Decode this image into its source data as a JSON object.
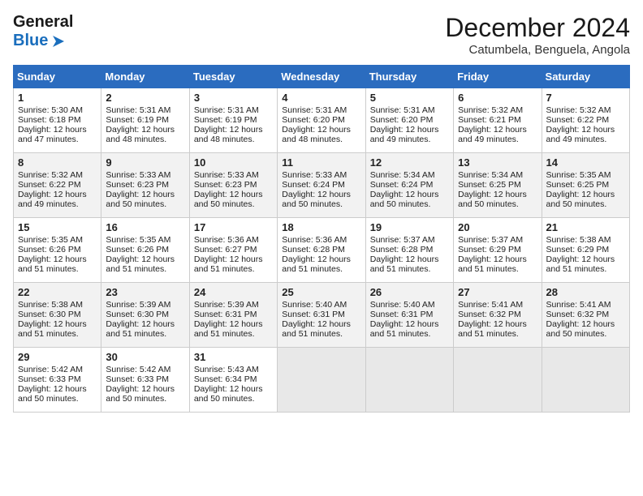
{
  "header": {
    "logo_line1": "General",
    "logo_line2": "Blue",
    "month": "December 2024",
    "location": "Catumbela, Benguela, Angola"
  },
  "weekdays": [
    "Sunday",
    "Monday",
    "Tuesday",
    "Wednesday",
    "Thursday",
    "Friday",
    "Saturday"
  ],
  "weeks": [
    [
      {
        "day": 1,
        "lines": [
          "Sunrise: 5:30 AM",
          "Sunset: 6:18 PM",
          "Daylight: 12 hours",
          "and 47 minutes."
        ]
      },
      {
        "day": 2,
        "lines": [
          "Sunrise: 5:31 AM",
          "Sunset: 6:19 PM",
          "Daylight: 12 hours",
          "and 48 minutes."
        ]
      },
      {
        "day": 3,
        "lines": [
          "Sunrise: 5:31 AM",
          "Sunset: 6:19 PM",
          "Daylight: 12 hours",
          "and 48 minutes."
        ]
      },
      {
        "day": 4,
        "lines": [
          "Sunrise: 5:31 AM",
          "Sunset: 6:20 PM",
          "Daylight: 12 hours",
          "and 48 minutes."
        ]
      },
      {
        "day": 5,
        "lines": [
          "Sunrise: 5:31 AM",
          "Sunset: 6:20 PM",
          "Daylight: 12 hours",
          "and 49 minutes."
        ]
      },
      {
        "day": 6,
        "lines": [
          "Sunrise: 5:32 AM",
          "Sunset: 6:21 PM",
          "Daylight: 12 hours",
          "and 49 minutes."
        ]
      },
      {
        "day": 7,
        "lines": [
          "Sunrise: 5:32 AM",
          "Sunset: 6:22 PM",
          "Daylight: 12 hours",
          "and 49 minutes."
        ]
      }
    ],
    [
      {
        "day": 8,
        "lines": [
          "Sunrise: 5:32 AM",
          "Sunset: 6:22 PM",
          "Daylight: 12 hours",
          "and 49 minutes."
        ]
      },
      {
        "day": 9,
        "lines": [
          "Sunrise: 5:33 AM",
          "Sunset: 6:23 PM",
          "Daylight: 12 hours",
          "and 50 minutes."
        ]
      },
      {
        "day": 10,
        "lines": [
          "Sunrise: 5:33 AM",
          "Sunset: 6:23 PM",
          "Daylight: 12 hours",
          "and 50 minutes."
        ]
      },
      {
        "day": 11,
        "lines": [
          "Sunrise: 5:33 AM",
          "Sunset: 6:24 PM",
          "Daylight: 12 hours",
          "and 50 minutes."
        ]
      },
      {
        "day": 12,
        "lines": [
          "Sunrise: 5:34 AM",
          "Sunset: 6:24 PM",
          "Daylight: 12 hours",
          "and 50 minutes."
        ]
      },
      {
        "day": 13,
        "lines": [
          "Sunrise: 5:34 AM",
          "Sunset: 6:25 PM",
          "Daylight: 12 hours",
          "and 50 minutes."
        ]
      },
      {
        "day": 14,
        "lines": [
          "Sunrise: 5:35 AM",
          "Sunset: 6:25 PM",
          "Daylight: 12 hours",
          "and 50 minutes."
        ]
      }
    ],
    [
      {
        "day": 15,
        "lines": [
          "Sunrise: 5:35 AM",
          "Sunset: 6:26 PM",
          "Daylight: 12 hours",
          "and 51 minutes."
        ]
      },
      {
        "day": 16,
        "lines": [
          "Sunrise: 5:35 AM",
          "Sunset: 6:26 PM",
          "Daylight: 12 hours",
          "and 51 minutes."
        ]
      },
      {
        "day": 17,
        "lines": [
          "Sunrise: 5:36 AM",
          "Sunset: 6:27 PM",
          "Daylight: 12 hours",
          "and 51 minutes."
        ]
      },
      {
        "day": 18,
        "lines": [
          "Sunrise: 5:36 AM",
          "Sunset: 6:28 PM",
          "Daylight: 12 hours",
          "and 51 minutes."
        ]
      },
      {
        "day": 19,
        "lines": [
          "Sunrise: 5:37 AM",
          "Sunset: 6:28 PM",
          "Daylight: 12 hours",
          "and 51 minutes."
        ]
      },
      {
        "day": 20,
        "lines": [
          "Sunrise: 5:37 AM",
          "Sunset: 6:29 PM",
          "Daylight: 12 hours",
          "and 51 minutes."
        ]
      },
      {
        "day": 21,
        "lines": [
          "Sunrise: 5:38 AM",
          "Sunset: 6:29 PM",
          "Daylight: 12 hours",
          "and 51 minutes."
        ]
      }
    ],
    [
      {
        "day": 22,
        "lines": [
          "Sunrise: 5:38 AM",
          "Sunset: 6:30 PM",
          "Daylight: 12 hours",
          "and 51 minutes."
        ]
      },
      {
        "day": 23,
        "lines": [
          "Sunrise: 5:39 AM",
          "Sunset: 6:30 PM",
          "Daylight: 12 hours",
          "and 51 minutes."
        ]
      },
      {
        "day": 24,
        "lines": [
          "Sunrise: 5:39 AM",
          "Sunset: 6:31 PM",
          "Daylight: 12 hours",
          "and 51 minutes."
        ]
      },
      {
        "day": 25,
        "lines": [
          "Sunrise: 5:40 AM",
          "Sunset: 6:31 PM",
          "Daylight: 12 hours",
          "and 51 minutes."
        ]
      },
      {
        "day": 26,
        "lines": [
          "Sunrise: 5:40 AM",
          "Sunset: 6:31 PM",
          "Daylight: 12 hours",
          "and 51 minutes."
        ]
      },
      {
        "day": 27,
        "lines": [
          "Sunrise: 5:41 AM",
          "Sunset: 6:32 PM",
          "Daylight: 12 hours",
          "and 51 minutes."
        ]
      },
      {
        "day": 28,
        "lines": [
          "Sunrise: 5:41 AM",
          "Sunset: 6:32 PM",
          "Daylight: 12 hours",
          "and 50 minutes."
        ]
      }
    ],
    [
      {
        "day": 29,
        "lines": [
          "Sunrise: 5:42 AM",
          "Sunset: 6:33 PM",
          "Daylight: 12 hours",
          "and 50 minutes."
        ]
      },
      {
        "day": 30,
        "lines": [
          "Sunrise: 5:42 AM",
          "Sunset: 6:33 PM",
          "Daylight: 12 hours",
          "and 50 minutes."
        ]
      },
      {
        "day": 31,
        "lines": [
          "Sunrise: 5:43 AM",
          "Sunset: 6:34 PM",
          "Daylight: 12 hours",
          "and 50 minutes."
        ]
      },
      null,
      null,
      null,
      null
    ]
  ]
}
